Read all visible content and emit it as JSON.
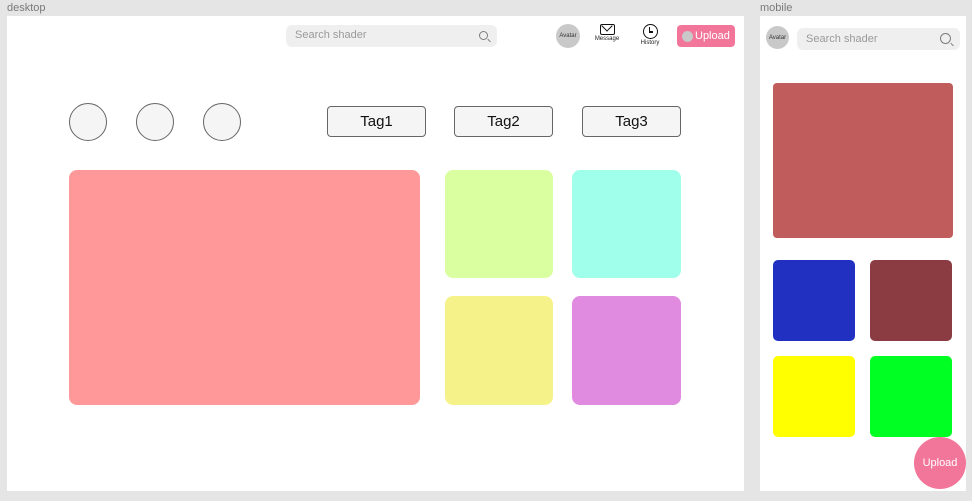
{
  "frames": {
    "desktop_label": "desktop",
    "mobile_label": "mobile"
  },
  "desktop": {
    "search": {
      "placeholder": "Search shader"
    },
    "avatar_text": "Avatar",
    "nav": {
      "message_label": "Message",
      "history_label": "History"
    },
    "upload_label": "Upload",
    "tags": [
      "Tag1",
      "Tag2",
      "Tag3"
    ],
    "tile_colors": {
      "featured": "#ff9999",
      "tile_1": "#d9ffa0",
      "tile_2": "#a0ffea",
      "tile_3": "#f6f28a",
      "tile_4": "#e08ae0"
    }
  },
  "mobile": {
    "avatar_text": "Avatar",
    "search": {
      "placeholder": "Search shader"
    },
    "upload_label": "Upload",
    "tile_colors": {
      "featured": "#c05c5c",
      "tile_1": "#2130c0",
      "tile_2": "#8a3c42",
      "tile_3": "#ffff00",
      "tile_4": "#00ff22"
    }
  },
  "accent_color": "#f2769a"
}
